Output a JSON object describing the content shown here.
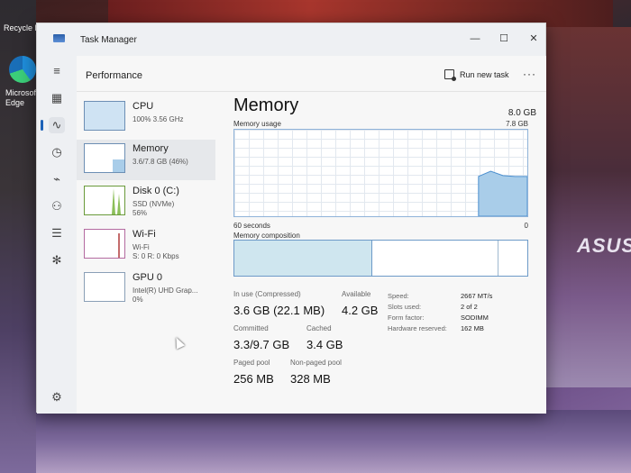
{
  "desktop": {
    "recycle_label": "Recycle B",
    "edge_label_1": "Microsoft",
    "edge_label_2": "Edge",
    "laptop_brand": "ASUS"
  },
  "window": {
    "title": "Task Manager",
    "minimize": "—",
    "maximize": "☐",
    "close": "✕"
  },
  "header": {
    "title": "Performance",
    "run_new_task": "Run new task",
    "more": "···"
  },
  "devices": [
    {
      "name": "CPU",
      "sub1": "100%  3.56 GHz",
      "sub2": "",
      "sub3": "",
      "fill": 1.0
    },
    {
      "name": "Memory",
      "sub1": "3.6/7.8 GB (46%)",
      "sub2": "",
      "sub3": "",
      "fill": 0.46
    },
    {
      "name": "Disk 0 (C:)",
      "sub1": "SSD (NVMe)",
      "sub2": "56%",
      "sub3": "",
      "fill": 0.56
    },
    {
      "name": "Wi-Fi",
      "sub1": "Wi-Fi",
      "sub2": "S: 0  R: 0 Kbps",
      "sub3": "",
      "fill": 0.05
    },
    {
      "name": "GPU 0",
      "sub1": "Intel(R) UHD Grap...",
      "sub2": "0%",
      "sub3": "",
      "fill": 0.0
    }
  ],
  "memory": {
    "title": "Memory",
    "total": "8.0 GB",
    "usage_label": "Memory usage",
    "usage_max": "7.8 GB",
    "time_label": "60 seconds",
    "time_end": "0",
    "composition_label": "Memory composition",
    "in_use_label": "In use (Compressed)",
    "in_use_value": "3.6 GB (22.1 MB)",
    "available_label": "Available",
    "available_value": "4.2 GB",
    "committed_label": "Committed",
    "committed_value": "3.3/9.7 GB",
    "cached_label": "Cached",
    "cached_value": "3.4 GB",
    "paged_label": "Paged pool",
    "paged_value": "256 MB",
    "nonpaged_label": "Non-paged pool",
    "nonpaged_value": "328 MB",
    "specs": [
      {
        "label": "Speed:",
        "value": "2667 MT/s"
      },
      {
        "label": "Slots used:",
        "value": "2 of 2"
      },
      {
        "label": "Form factor:",
        "value": "SODIMM"
      },
      {
        "label": "Hardware reserved:",
        "value": "162 MB"
      }
    ],
    "usage_history_fraction": [
      0,
      0,
      0,
      0,
      0,
      0,
      0,
      0,
      0,
      0,
      0,
      0,
      0,
      0,
      0,
      0,
      0,
      0,
      0,
      0,
      0.46,
      0.52,
      0.47,
      0.46,
      0.46
    ],
    "composition_in_use_fraction": 0.47,
    "composition_standby_fraction": 0.43
  },
  "colors": {
    "accent": "#1d62b8",
    "graph_fill": "#a9cde9",
    "graph_line": "#4b8fcf",
    "composition_fill": "#cfe6ef"
  }
}
